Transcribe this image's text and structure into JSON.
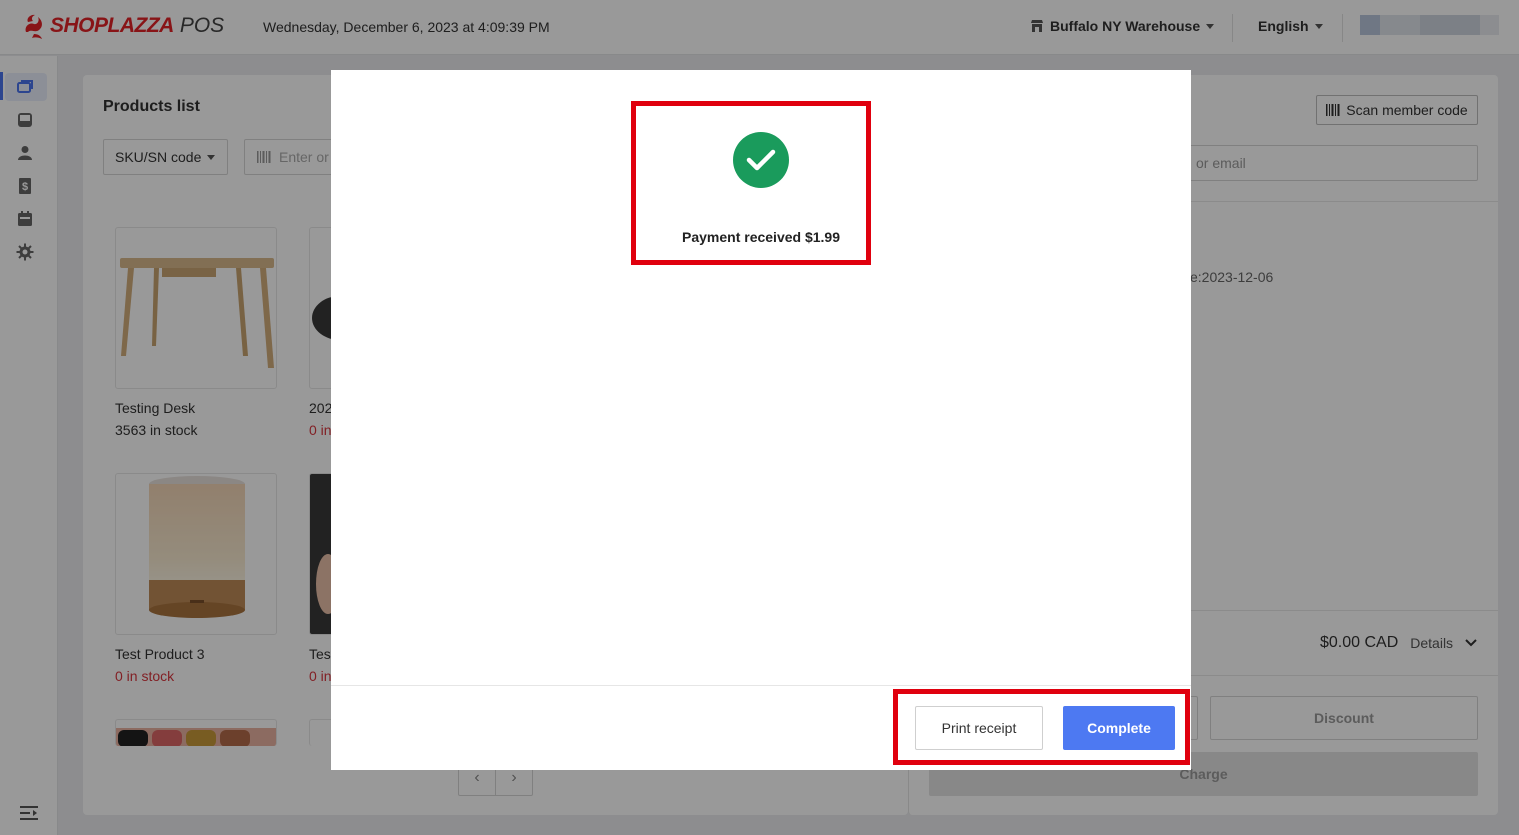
{
  "app": {
    "logo_text": "SHOPLAZZA",
    "logo_suffix": "POS"
  },
  "header": {
    "datetime": "Wednesday, December 6, 2023 at 4:09:39 PM",
    "location": "Buffalo NY Warehouse",
    "language": "English"
  },
  "sidebar": {
    "items": [
      {
        "icon": "register-icon",
        "active": true
      },
      {
        "icon": "inbox-icon"
      },
      {
        "icon": "customer-icon"
      },
      {
        "icon": "dollar-receipt-icon"
      },
      {
        "icon": "calendar-icon"
      },
      {
        "icon": "settings-gear-icon"
      }
    ],
    "collapse_icon": "menu-collapse-icon"
  },
  "products": {
    "title": "Products list",
    "filter_label": "SKU/SN code",
    "search_placeholder": "Enter or",
    "items": [
      {
        "name": "Testing Desk",
        "stock": "3563 in stock"
      },
      {
        "name": "202",
        "stock": "0 in"
      },
      {
        "name": "Test Product 3",
        "stock": "0 in stock"
      },
      {
        "name": "Test",
        "stock": "0 in"
      }
    ]
  },
  "cart": {
    "scan_member_label": "Scan member code",
    "member_placeholder_tail": "or email",
    "date_fragment": "e:2023-12-06",
    "total": "$0.00 CAD",
    "details_label": "Details",
    "discount_label": "Discount",
    "charge_label": "Charge"
  },
  "modal": {
    "status_icon": "success-check-icon",
    "message": "Payment received $1.99",
    "print_label": "Print receipt",
    "complete_label": "Complete"
  },
  "colors": {
    "brand_red": "#e32227",
    "success_green": "#1a9b5c",
    "primary_blue": "#4d79f2",
    "annotation_red": "#e0000e"
  }
}
